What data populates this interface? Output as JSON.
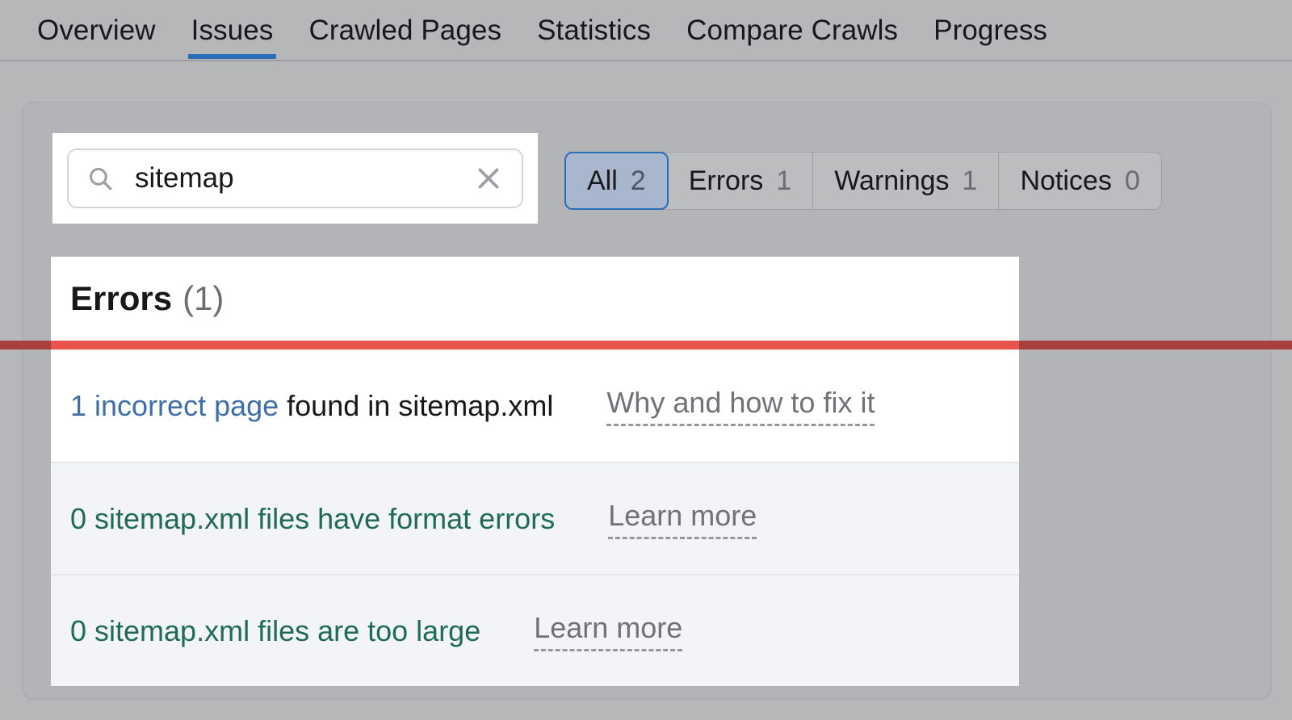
{
  "topnav": {
    "tabs": [
      {
        "label": "Overview",
        "active": false
      },
      {
        "label": "Issues",
        "active": true
      },
      {
        "label": "Crawled Pages",
        "active": false
      },
      {
        "label": "Statistics",
        "active": false
      },
      {
        "label": "Compare Crawls",
        "active": false
      },
      {
        "label": "Progress",
        "active": false
      }
    ]
  },
  "search": {
    "value": "sitemap",
    "placeholder": "Search",
    "icon": "search-icon",
    "clear_icon": "close-icon"
  },
  "filters": {
    "tabs": [
      {
        "label": "All",
        "count": "2",
        "selected": true
      },
      {
        "label": "Errors",
        "count": "1",
        "selected": false
      },
      {
        "label": "Warnings",
        "count": "1",
        "selected": false
      },
      {
        "label": "Notices",
        "count": "0",
        "selected": false
      }
    ]
  },
  "issues": {
    "section_title": "Errors",
    "section_count": "(1)",
    "accent_color": "#e8534c",
    "rows": [
      {
        "lead": "1 incorrect page",
        "lead_style": "link",
        "rest": " found in sitemap.xml",
        "rest_style": "dark",
        "help": "Why and how to fix it",
        "tint": false
      },
      {
        "lead": "0 sitemap.xml files have format errors",
        "lead_style": "ok",
        "rest": "",
        "rest_style": "ok",
        "help": "Learn more",
        "tint": true
      },
      {
        "lead": "0 sitemap.xml files are too large",
        "lead_style": "ok",
        "rest": "",
        "rest_style": "ok",
        "help": "Learn more",
        "tint": true
      }
    ]
  }
}
